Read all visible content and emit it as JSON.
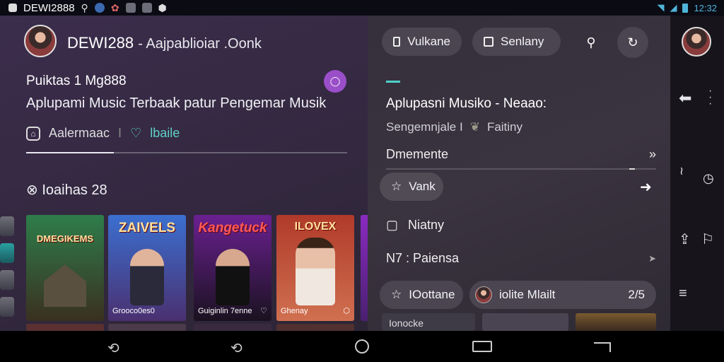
{
  "status_bar": {
    "title": "DEWI2888",
    "time": "12:32",
    "icons": [
      "picture-icon",
      "key-icon",
      "globe-icon",
      "flower-icon",
      "photo-icon",
      "gallery-icon",
      "shield-icon"
    ],
    "right_icons": [
      "wifi-icon",
      "signal-icon",
      "battery-icon"
    ]
  },
  "header": {
    "app_name": "DEWI288",
    "app_subtitle": "- Aajpablioiar .Oonk",
    "heading": "Puiktas 1 Mg888",
    "tagline": "Aplupami Music Terbaak patur Pengemar Musik",
    "action_1": "Aalermaac",
    "action_sep": "I",
    "action_2": "lbaile",
    "section_label": "Ioaihas 28"
  },
  "cards": [
    {
      "title": "DMEGIKEMS",
      "caption": "",
      "color_top": "#2e7d4a",
      "color_bottom": "#3a3020"
    },
    {
      "title": "ZAIVELS",
      "caption": "Grooco0es0",
      "color_top": "#3b6fd0",
      "color_bottom": "#4a3070"
    },
    {
      "title": "Kangetuck",
      "caption": "Guiginlin 7enne",
      "color_top": "#6a2090",
      "color_bottom": "#1a1220"
    },
    {
      "title": "ILOVEX",
      "caption": "Ghenay",
      "color_top": "#b03a2a",
      "color_bottom": "#d07050"
    }
  ],
  "right_panel": {
    "tab_1": "Vulkane",
    "tab_2": "Senlany",
    "title": "Aplupasni Musiko - Neaao:",
    "sub_left": "Sengemnjale I",
    "sub_right": "Faitiny",
    "row_1": "Dmemente",
    "pill_1": "Vank",
    "row_2": "Niatny",
    "row_3": "N7 : Paiensa",
    "pill_2": "IOottane",
    "pill_3": "iolite Mlailt",
    "pill_3_count": "2/5",
    "peek_label": "Ionocke"
  },
  "colors": {
    "accent_teal": "#4fd0c8",
    "accent_purple": "#9a4fc9",
    "pill_bg": "#4a4550"
  }
}
